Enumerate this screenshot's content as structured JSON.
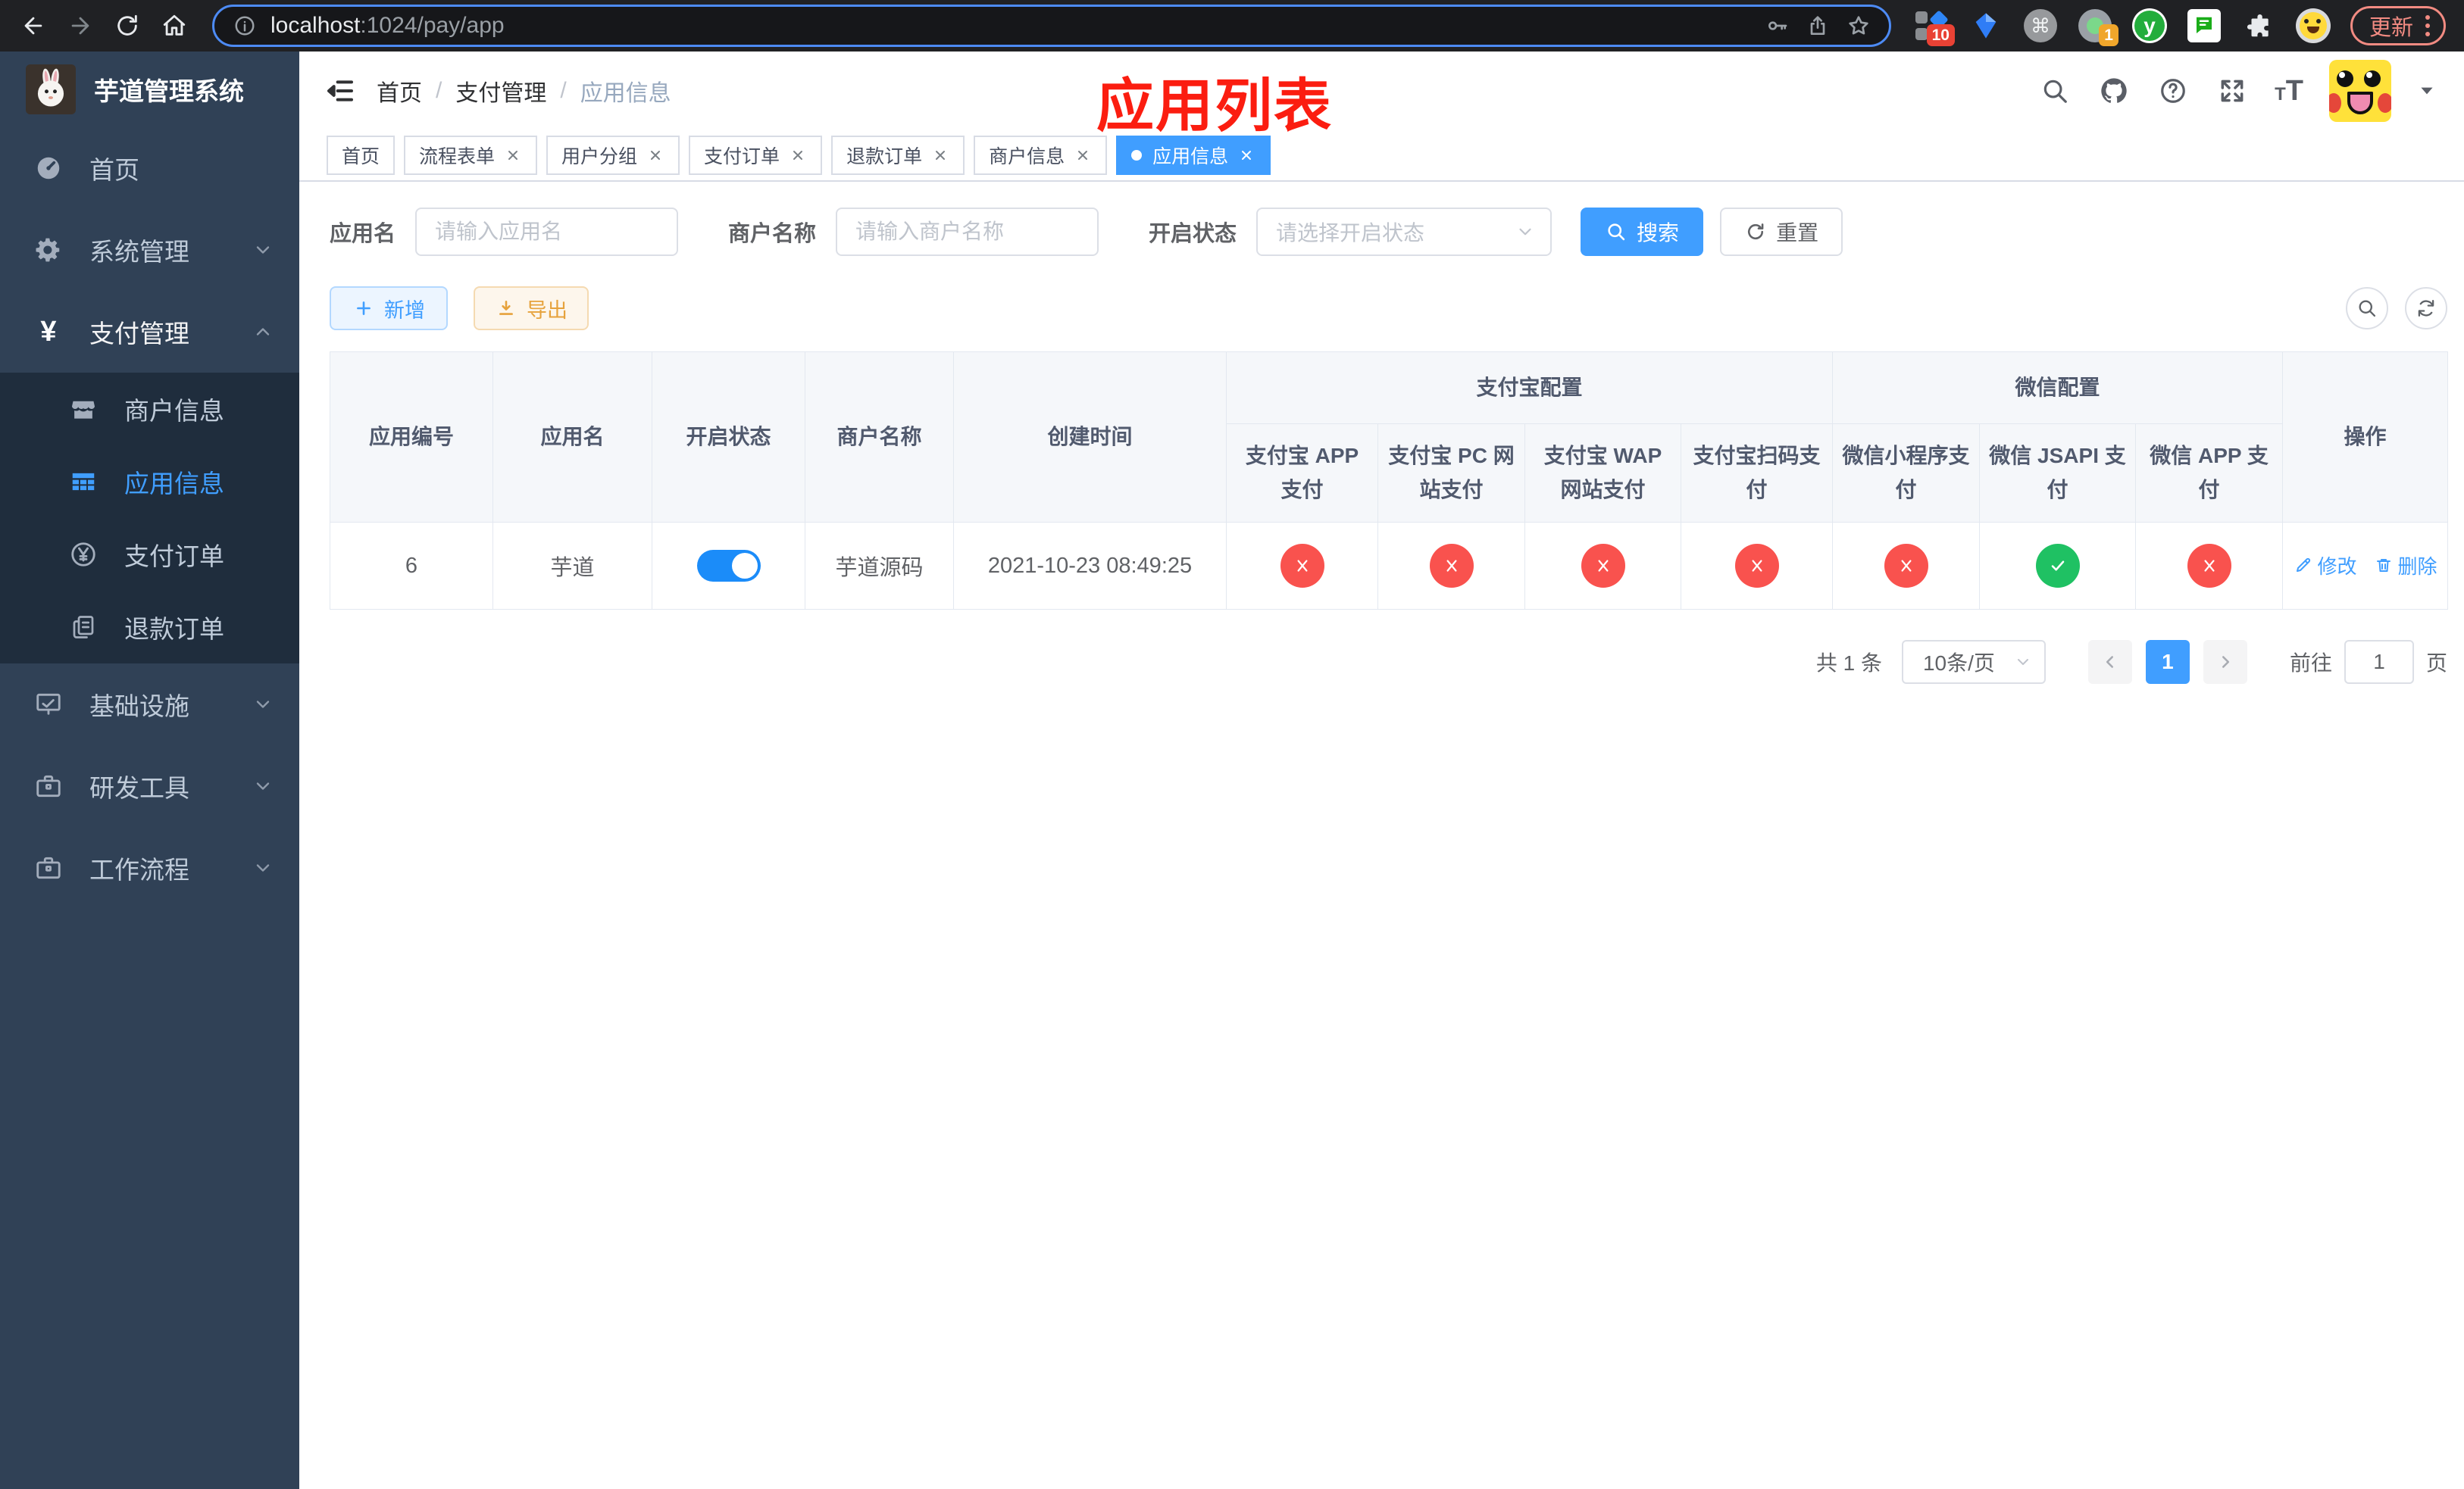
{
  "browser": {
    "url": {
      "host": "localhost",
      "rest": ":1024/pay/app"
    },
    "update_button": "更新",
    "ext_badge_blue_diamond": "10",
    "ext_badge_camera": "1",
    "ext_y_letter": "y",
    "ext_cmd_glyph": "⌘"
  },
  "sidebar": {
    "title": "芋道管理系统",
    "items": [
      {
        "label": "首页"
      },
      {
        "label": "系统管理"
      },
      {
        "label": "支付管理"
      },
      {
        "label": "商户信息"
      },
      {
        "label": "应用信息"
      },
      {
        "label": "支付订单"
      },
      {
        "label": "退款订单"
      },
      {
        "label": "基础设施"
      },
      {
        "label": "研发工具"
      },
      {
        "label": "工作流程"
      }
    ]
  },
  "header": {
    "breadcrumb": [
      "首页",
      "支付管理",
      "应用信息"
    ],
    "breadcrumb_sep": "/",
    "annotation": "应用列表"
  },
  "tabs": [
    {
      "label": "首页"
    },
    {
      "label": "流程表单"
    },
    {
      "label": "用户分组"
    },
    {
      "label": "支付订单"
    },
    {
      "label": "退款订单"
    },
    {
      "label": "商户信息"
    },
    {
      "label": "应用信息"
    }
  ],
  "filters": {
    "app_name_label": "应用名",
    "app_name_placeholder": "请输入应用名",
    "merchant_label": "商户名称",
    "merchant_placeholder": "请输入商户名称",
    "status_label": "开启状态",
    "status_placeholder": "请选择开启状态",
    "search_label": "搜索",
    "reset_label": "重置"
  },
  "toolbar": {
    "add_label": "新增",
    "export_label": "导出"
  },
  "table": {
    "headers": {
      "app_id": "应用编号",
      "app_name": "应用名",
      "status": "开启状态",
      "merchant": "商户名称",
      "created": "创建时间",
      "alipay_group": "支付宝配置",
      "wechat_group": "微信配置",
      "actions": "操作",
      "channels": [
        "支付宝 APP 支付",
        "支付宝 PC 网站支付",
        "支付宝 WAP 网站支付",
        "支付宝扫码支付",
        "微信小程序支付",
        "微信 JSAPI 支付",
        "微信 APP 支付"
      ]
    },
    "rows": [
      {
        "id": "6",
        "name": "芋道",
        "enabled": true,
        "merchant": "芋道源码",
        "created": "2021-10-23 08:49:25",
        "channel_status": [
          "closed",
          "closed",
          "closed",
          "closed",
          "closed",
          "open",
          "closed"
        ],
        "edit_label": "修改",
        "delete_label": "删除"
      }
    ]
  },
  "pagination": {
    "total": "共 1 条",
    "page_size": "10条/页",
    "current_page": "1",
    "goto_label": "前往",
    "goto_value": "1",
    "unit_label": "页"
  },
  "colors": {
    "primary": "#409EFF",
    "success": "#1fc163",
    "danger": "#f9524e",
    "warning": "#e6a23c",
    "toggle": "#1b8cf9",
    "sidebar_bg": "#304156",
    "sidebar_sub": "#1f2d3d",
    "sidebar_text": "#bfcbd9",
    "annotation": "#fb1d10",
    "chrome_bg": "#202124",
    "url_border": "#4d8bf5",
    "update": "#f28b82"
  }
}
